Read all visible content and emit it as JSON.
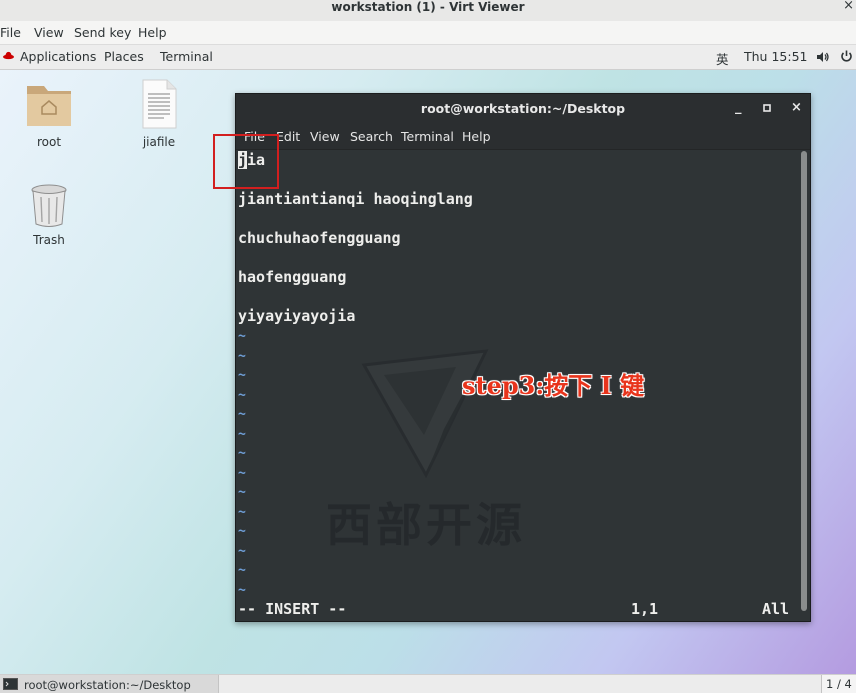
{
  "viewer": {
    "title": "workstation (1) - Virt Viewer",
    "close_glyph": "×",
    "menu": [
      "File",
      "View",
      "Send key",
      "Help"
    ]
  },
  "panel": {
    "applications": "Applications",
    "places": "Places",
    "terminal": "Terminal",
    "input_method": "英",
    "clock": "Thu 15:51"
  },
  "desktop": {
    "icons": [
      {
        "label": "root",
        "icon": "home-folder-icon"
      },
      {
        "label": "jiafile",
        "icon": "text-file-icon"
      },
      {
        "label": "Trash",
        "icon": "trash-icon"
      }
    ]
  },
  "terminal": {
    "title": "root@workstation:~/Desktop",
    "menu": [
      "File",
      "Edit",
      "View",
      "Search",
      "Terminal",
      "Help"
    ],
    "cursor_char": "j",
    "lines": [
      "ia",
      "jiantiantianqi haoqinglang",
      "chuchuhaofengguang",
      "haofengguang",
      "yiyayiyayojia"
    ],
    "tilde": "~",
    "status_mode": "-- INSERT --",
    "status_pos": "1,1",
    "status_all": "All"
  },
  "annotation": {
    "step_text": "step3:按下 I 键"
  },
  "watermark": {
    "text": "西部开源"
  },
  "taskbar": {
    "window_label": "root@workstation:~/Desktop",
    "workspace": "1 / 4"
  },
  "colors": {
    "terminal_bg": "#2f3436",
    "tilde_blue": "#6f9fd8",
    "annotation_red": "#e8341c",
    "box_red": "#d21f1f"
  }
}
